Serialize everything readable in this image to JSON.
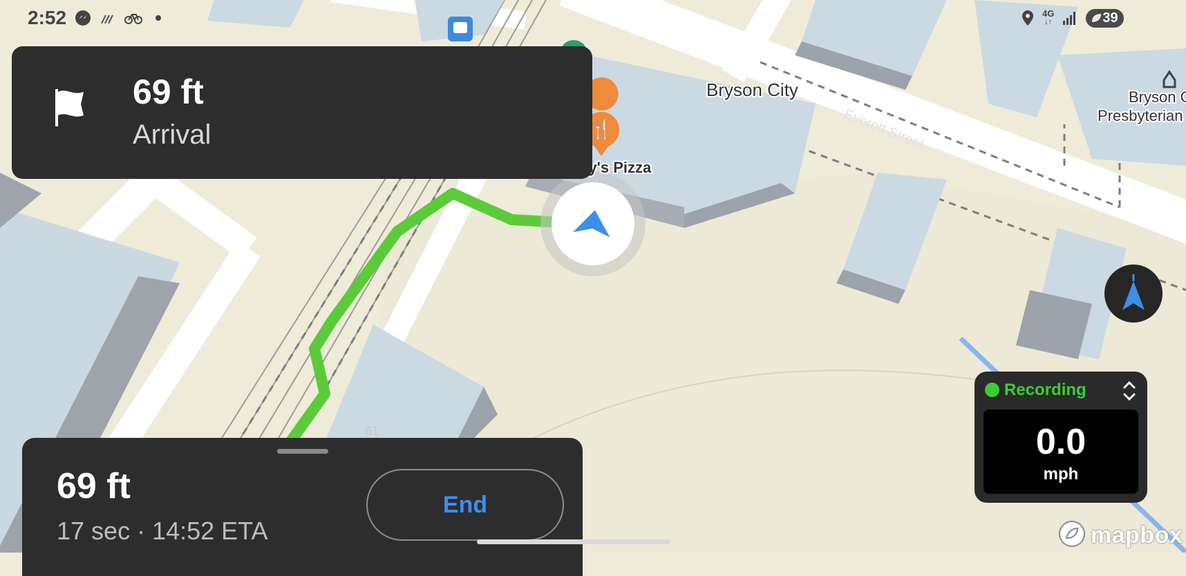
{
  "status_bar": {
    "time": "2:52",
    "right_network": "4G",
    "battery": "39",
    "left_icons": [
      "messenger-icon",
      "no-signal-icon",
      "bicycle-icon",
      "dot-icon"
    ],
    "right_icons": [
      "location-icon",
      "network-4g-icon",
      "signal-icon",
      "battery-icon"
    ]
  },
  "map": {
    "labels": {
      "city": "Bryson City",
      "poi_pizza": "ny's Pizza",
      "street": "Everett Street",
      "church_line1": "Bryson C",
      "church_line2": "Presbyterian C",
      "route_number": "61"
    },
    "colors": {
      "route": "#5bcb3a",
      "user_arrow": "#3d8fe8",
      "pizza_pin": "#f08a3c",
      "background": "#eeebd9"
    }
  },
  "maneuver": {
    "distance": "69 ft",
    "instruction": "Arrival",
    "icon": "flag-icon"
  },
  "trip": {
    "remaining_distance": "69 ft",
    "summary": "17 sec · 14:52 ETA",
    "end_label": "End"
  },
  "recorder": {
    "status": "Recording",
    "speed": "0.0",
    "unit": "mph"
  },
  "attribution": {
    "brand": "mapbox"
  }
}
